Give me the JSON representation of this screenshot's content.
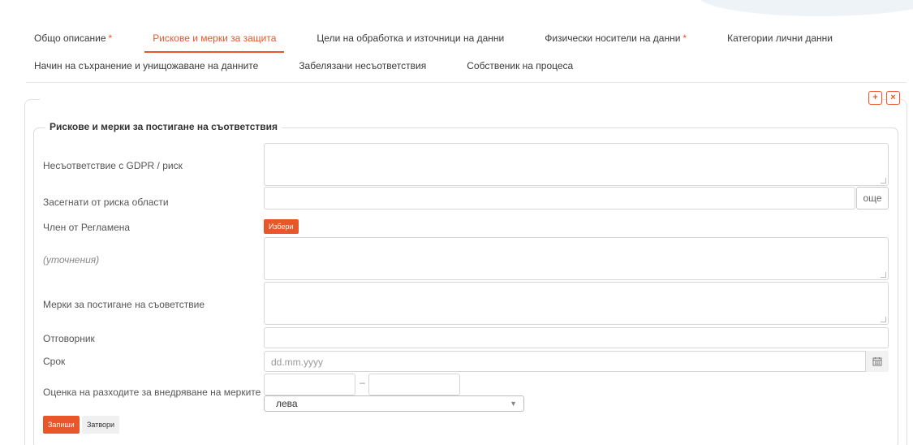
{
  "tabs": {
    "row1": [
      {
        "label": "Общо описание",
        "required_mark": "*",
        "active": false
      },
      {
        "label": "Рискове и мерки за защита",
        "required_mark": "",
        "active": true
      },
      {
        "label": "Цели на обработка и източници на данни",
        "required_mark": "",
        "active": false
      },
      {
        "label": "Физически носители на данни",
        "required_mark": "*",
        "active": false
      },
      {
        "label": "Категории лични данни",
        "required_mark": "",
        "active": false
      }
    ],
    "row2": [
      {
        "label": "Начин на съхранение и унищожаване на данните"
      },
      {
        "label": "Забелязани несъответствия"
      },
      {
        "label": "Собственик на процеса"
      }
    ]
  },
  "panel": {
    "add_icon": "+",
    "close_icon": "×",
    "legend": "Рискове и мерки за постигане на съответствия"
  },
  "form": {
    "nonconformity_label": "Несъответствие с GDPR / риск",
    "nonconformity_value": "",
    "affected_areas_label": "Засегнати от риска области",
    "affected_areas_value": "",
    "more_button": "още",
    "regulation_article_label": "Член от Регламена",
    "choose_button": "Избери",
    "clarification_label": "(уточнения)",
    "clarification_value": "",
    "measures_label": "Мерки за постигане на съоветствие",
    "measures_value": "",
    "responsible_label": "Отговорник",
    "responsible_value": "",
    "deadline_label": "Срок",
    "deadline_placeholder": "dd.mm.yyyy",
    "cost_label": "Оценка на разходите за внедряване на мерките",
    "cost_from": "",
    "cost_dash": "–",
    "cost_to": "",
    "currency_selected": "лева",
    "save_button": "Запиши",
    "cancel_button": "Затвори"
  },
  "colors": {
    "accent": "#e8562a",
    "border": "#d6d6d6",
    "text": "#333333"
  }
}
